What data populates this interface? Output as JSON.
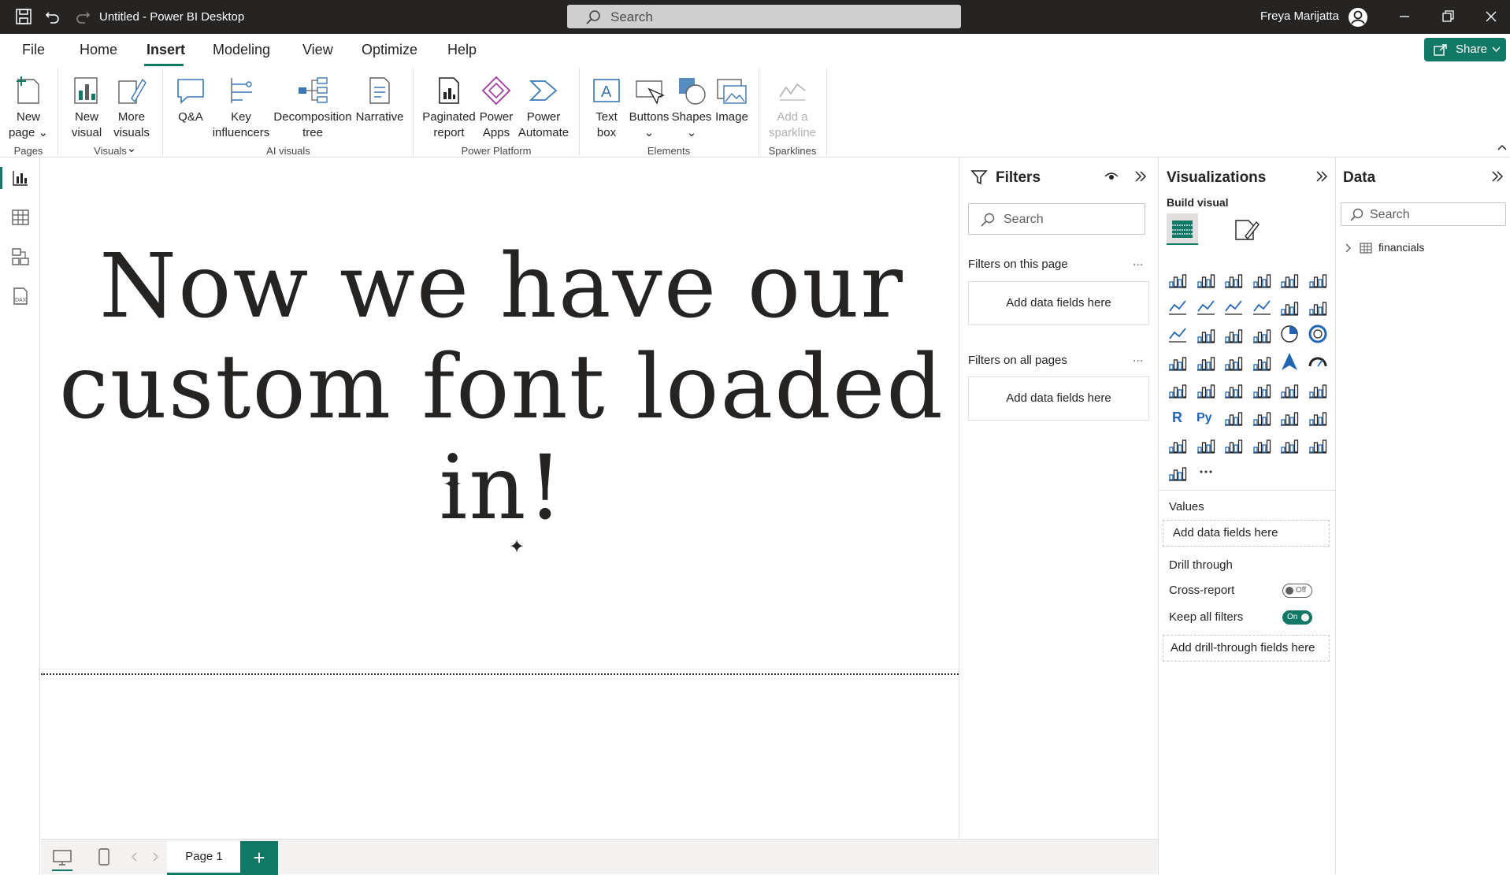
{
  "titlebar": {
    "title": "Untitled - Power BI Desktop",
    "search_placeholder": "Search",
    "user_name": "Freya Marijatta"
  },
  "menu": {
    "items": [
      "File",
      "Home",
      "Insert",
      "Modeling",
      "View",
      "Optimize",
      "Help"
    ],
    "active": "Insert",
    "share_label": "Share"
  },
  "ribbon": {
    "new_page": [
      "New",
      "page"
    ],
    "new_visual": [
      "New",
      "visual"
    ],
    "more_visuals": [
      "More",
      "visuals"
    ],
    "qa": "Q&A",
    "key_influencers": [
      "Key",
      "influencers"
    ],
    "decomposition_tree": [
      "Decomposition",
      "tree"
    ],
    "narrative": "Narrative",
    "paginated_report": [
      "Paginated",
      "report"
    ],
    "power_apps": [
      "Power",
      "Apps"
    ],
    "power_automate": [
      "Power",
      "Automate"
    ],
    "text_box": [
      "Text",
      "box"
    ],
    "buttons": "Buttons",
    "shapes": "Shapes",
    "image": "Image",
    "sparkline": [
      "Add a",
      "sparkline"
    ],
    "groups": {
      "pages": "Pages",
      "visuals": "Visuals",
      "ai_visuals": "AI visuals",
      "power_platform": "Power Platform",
      "elements": "Elements",
      "sparklines": "Sparklines"
    }
  },
  "canvas": {
    "text_lines": [
      "Now we have our",
      "custom font loaded",
      "in!"
    ]
  },
  "pages": {
    "tab": "Page 1",
    "add": "+"
  },
  "filters": {
    "title": "Filters",
    "search_placeholder": "Search",
    "on_this_page": "Filters on this page",
    "on_all_pages": "Filters on all pages",
    "add_fields": "Add data fields here",
    "more": "..."
  },
  "visualizations": {
    "title": "Visualizations",
    "build_visual": "Build visual",
    "values_label": "Values",
    "values_well": "Add data fields here",
    "drill_through": "Drill through",
    "cross_report": "Cross-report",
    "cross_report_state": "Off",
    "keep_all_filters": "Keep all filters",
    "keep_all_filters_state": "On",
    "drill_well": "Add drill-through fields here",
    "more": "..."
  },
  "data": {
    "title": "Data",
    "search_placeholder": "Search",
    "tables": [
      "financials"
    ]
  },
  "colors": {
    "accent": "#117865",
    "titlebar": "#252423"
  }
}
